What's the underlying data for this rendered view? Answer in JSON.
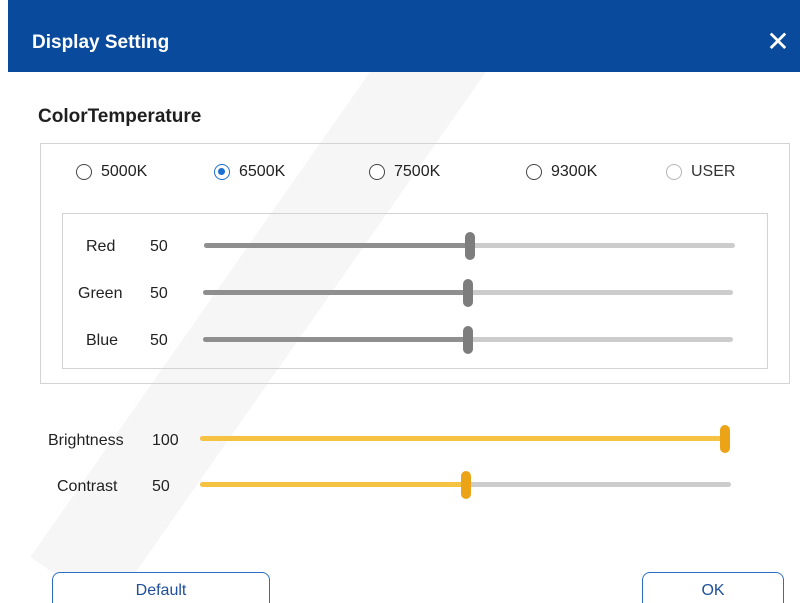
{
  "window": {
    "title": "Display Setting",
    "close_icon": "close-icon"
  },
  "color_temperature": {
    "label": "ColorTemperature",
    "options": [
      {
        "label": "5000K",
        "state": "unchecked"
      },
      {
        "label": "6500K",
        "state": "checked"
      },
      {
        "label": "7500K",
        "state": "unchecked"
      },
      {
        "label": "9300K",
        "state": "unchecked"
      },
      {
        "label": "USER",
        "state": "disabled"
      }
    ],
    "channels": [
      {
        "name": "Red",
        "value": "50",
        "level": 0.5
      },
      {
        "name": "Green",
        "value": "50",
        "level": 0.5
      },
      {
        "name": "Blue",
        "value": "50",
        "level": 0.5
      }
    ]
  },
  "adjustments": [
    {
      "name": "Brightness",
      "value": "100",
      "level": 1.0
    },
    {
      "name": "Contrast",
      "value": "50",
      "level": 0.5
    }
  ],
  "buttons": {
    "default_label": "Default",
    "ok_label": "OK"
  },
  "colors": {
    "title_bar": "#0a4a9c",
    "accent": "#1a6fd0",
    "slider_gray": "#8f8f8f",
    "slider_gold": "#f5c242",
    "thumb_gold": "#eba418"
  }
}
